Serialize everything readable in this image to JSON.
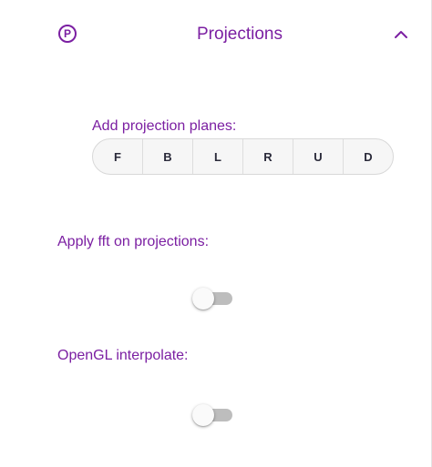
{
  "header": {
    "icon_letter": "P",
    "title": "Projections",
    "expanded": true
  },
  "planes": {
    "label": "Add projection planes:",
    "buttons": [
      "F",
      "B",
      "L",
      "R",
      "U",
      "D"
    ]
  },
  "fft": {
    "label": "Apply fft on projections:",
    "enabled": false
  },
  "opengl": {
    "label": "OpenGL interpolate:",
    "enabled": false
  },
  "colors": {
    "accent": "#7b1fa2",
    "toggle_track_off": "#bdbdbd",
    "toggle_thumb": "#fafafa"
  }
}
